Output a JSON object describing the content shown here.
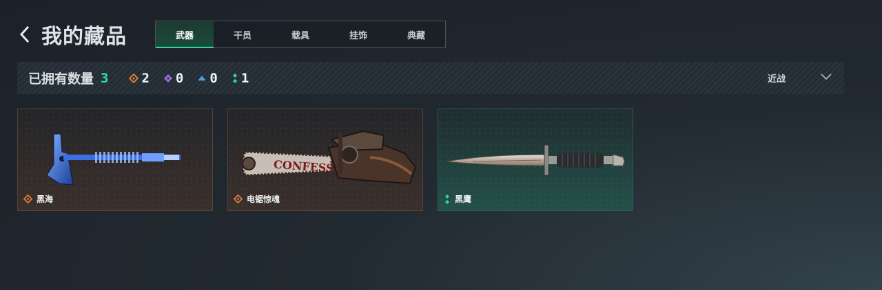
{
  "header": {
    "title": "我的藏品"
  },
  "tabs": [
    {
      "label": "武器",
      "active": true
    },
    {
      "label": "干员",
      "active": false
    },
    {
      "label": "载具",
      "active": false
    },
    {
      "label": "挂饰",
      "active": false
    },
    {
      "label": "典藏",
      "active": false
    }
  ],
  "summary": {
    "owned_label": "已拥有数量",
    "owned_total": "3",
    "rarity_counts": [
      {
        "icon": "orange-diamond-icon",
        "color": "#d97b3c",
        "count": "2"
      },
      {
        "icon": "purple-diamond-icon",
        "color": "#9b6ad6",
        "count": "0"
      },
      {
        "icon": "blue-triangle-icon",
        "color": "#4aa3e6",
        "count": "0"
      },
      {
        "icon": "green-dots-icon",
        "color": "#2fd6a0",
        "count": "1"
      }
    ],
    "filter": {
      "selected": "近战"
    }
  },
  "items": [
    {
      "name": "黑海",
      "rarity_color": "#d97b3c",
      "rarity_icon": "orange-diamond-icon",
      "image": "tomahawk-axe"
    },
    {
      "name": "电锯惊魂",
      "rarity_color": "#d97b3c",
      "rarity_icon": "orange-diamond-icon",
      "image": "chainsaw"
    },
    {
      "name": "黑鹰",
      "rarity_color": "#2fd6a0",
      "rarity_icon": "green-dots-icon",
      "image": "combat-knife"
    }
  ],
  "chainsaw_text": "CONFESS"
}
